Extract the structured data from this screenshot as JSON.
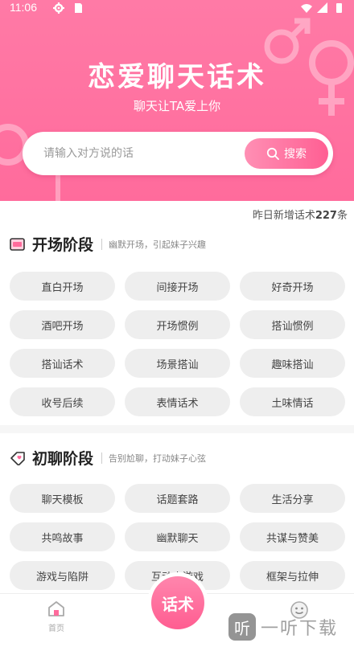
{
  "status_bar": {
    "time": "11:06"
  },
  "colors": {
    "brand_pink": "#ff6b9c",
    "chip_bg": "#eeeeee",
    "page_bg": "#ffffff"
  },
  "header": {
    "title": "恋爱聊天话术",
    "subtitle": "聊天让TA爱上你"
  },
  "search": {
    "placeholder": "请输入对方说的话",
    "button_label": "搜索",
    "icon": "search-icon"
  },
  "stats": {
    "new_prefix": "昨日新增话术",
    "new_count": "227",
    "new_suffix": "条"
  },
  "sections": [
    {
      "icon": "message-card-icon",
      "title": "开场阶段",
      "desc": "幽默开场，引起妹子兴趣",
      "chips": [
        "直白开场",
        "间接开场",
        "好奇开场",
        "酒吧开场",
        "开场惯例",
        "搭讪惯例",
        "搭讪话术",
        "场景搭讪",
        "趣味搭讪",
        "收号后续",
        "表情话术",
        "土味情话"
      ]
    },
    {
      "icon": "tag-heart-icon",
      "title": "初聊阶段",
      "desc": "告别尬聊，打动妹子心弦",
      "chips": [
        "聊天模板",
        "话题套路",
        "生活分享",
        "共鸣故事",
        "幽默聊天",
        "共谋与赞美",
        "游戏与陷阱",
        "互动小游戏",
        "框架与拉伸"
      ]
    }
  ],
  "bottom_nav": {
    "home_label": "首页",
    "center_label": "话术",
    "home_icon": "home-icon",
    "me_icon": "smiley-icon"
  },
  "watermark": {
    "badge": "听",
    "text": "一听下载"
  }
}
